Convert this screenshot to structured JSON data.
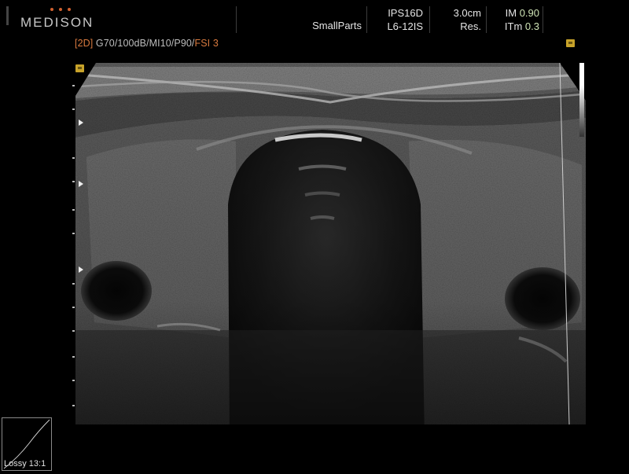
{
  "brand": {
    "name": "MEDISON",
    "dot_color": "#d2612f"
  },
  "header": {
    "preset": "SmallParts",
    "probe_code": "IPS16D",
    "transducer": "L6-12IS",
    "depth": "3.0cm",
    "resolution": "Res.",
    "im_label": "IM",
    "im_value": "0.90",
    "itm_label": "ITm",
    "itm_value": "0.3"
  },
  "params": {
    "mode": "[2D]",
    "settings": " G70/100dB/MI10/P90/",
    "fsi": "FSI 3"
  },
  "footer": {
    "compression": "Lossy 13:1"
  },
  "colors": {
    "accent_orange": "#d87a3f",
    "im_green": "#cfe4b6",
    "marker_yellow": "#c8a32a"
  },
  "icons": {
    "orientation_marker": "square-marker-icon",
    "corner_badge": "badge-icon",
    "focus_marker": "triangle-right-icon"
  }
}
